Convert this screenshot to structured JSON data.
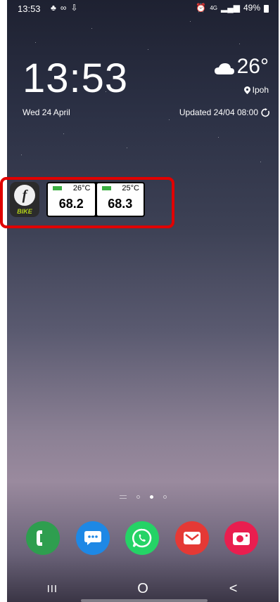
{
  "status_bar": {
    "time": "13:53",
    "network": "4G",
    "battery": "49%"
  },
  "clock_widget": {
    "time": "13:53",
    "date": "Wed 24 April",
    "temperature": "26°",
    "location": "Ipoh",
    "updated": "Updated 24/04 08:00"
  },
  "app_widget": {
    "app_label": "BIKE",
    "sensors": [
      {
        "temp": "26°C",
        "value": "68.2"
      },
      {
        "temp": "25°C",
        "value": "68.3"
      }
    ]
  },
  "dock": [
    {
      "name": "phone",
      "color": "#2e9e4f"
    },
    {
      "name": "messages",
      "color": "#1e88e5"
    },
    {
      "name": "whatsapp",
      "color": "#25d366"
    },
    {
      "name": "email",
      "color": "#e53935"
    },
    {
      "name": "camera",
      "color": "#e91e4f"
    }
  ],
  "colors": {
    "highlight": "#e00000",
    "sensor_bar": "#3cb043"
  },
  "nav": {
    "recents": "III",
    "home": "O",
    "back": "<"
  }
}
